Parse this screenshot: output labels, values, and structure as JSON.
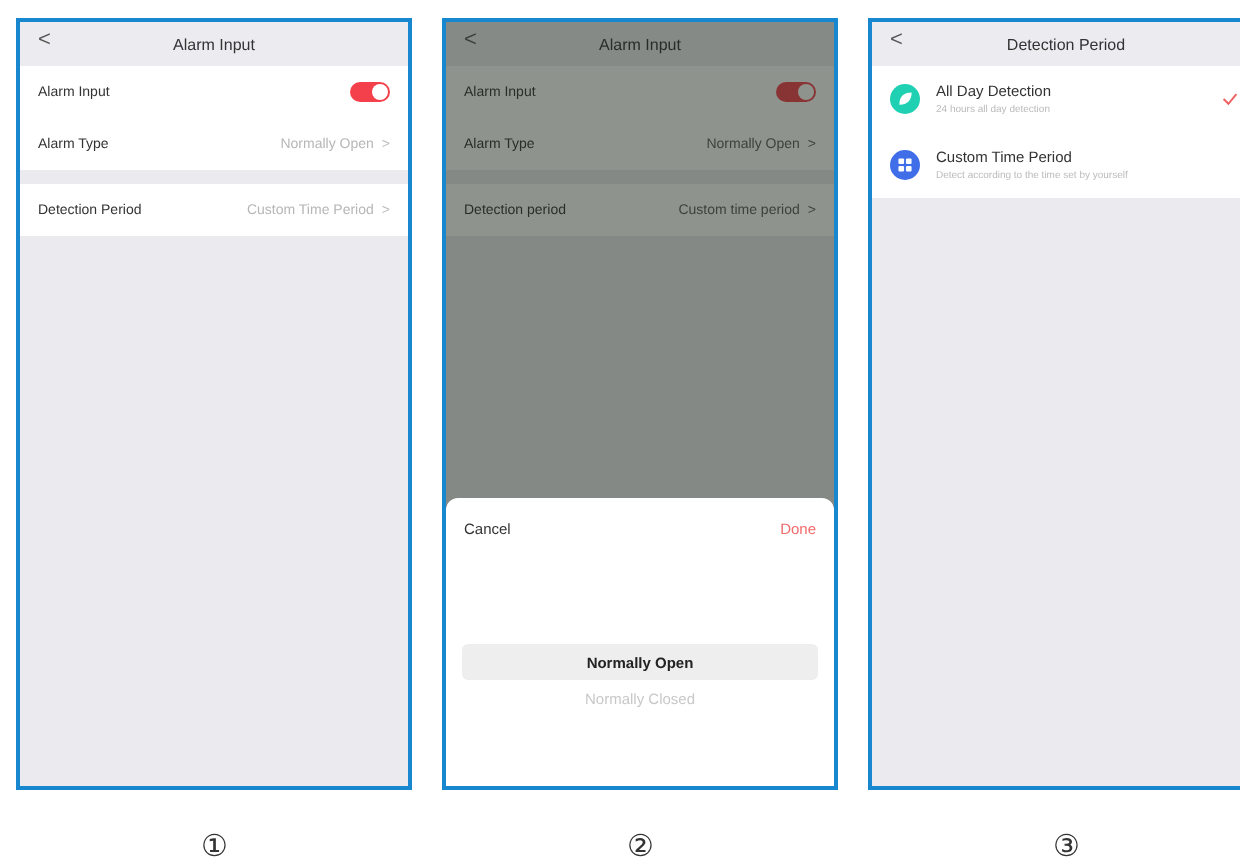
{
  "screens": [
    {
      "kind": "settings",
      "title": "Alarm Input",
      "back": "<",
      "dimmed": false,
      "groups": [
        {
          "rows": [
            {
              "kind": "toggle",
              "label": "Alarm Input",
              "on": true
            },
            {
              "kind": "value",
              "label": "Alarm Type",
              "value": "Normally Open",
              "chevron": ">"
            }
          ]
        },
        {
          "rows": [
            {
              "kind": "value",
              "label": "Detection Period",
              "value": "Custom Time Period",
              "chevron": ">"
            }
          ]
        }
      ],
      "caption": "①"
    },
    {
      "kind": "settings",
      "title": "Alarm Input",
      "back": "<",
      "dimmed": true,
      "groups": [
        {
          "rows": [
            {
              "kind": "toggle",
              "label": "Alarm Input",
              "on": true
            },
            {
              "kind": "value",
              "label": "Alarm Type",
              "value": "Normally Open",
              "chevron": ">"
            }
          ]
        },
        {
          "rows": [
            {
              "kind": "value",
              "label": "Detection period",
              "value": "Custom time period",
              "chevron": ">"
            }
          ]
        }
      ],
      "picker": {
        "cancel": "Cancel",
        "done": "Done",
        "options": [
          {
            "label": "Normally Open",
            "selected": true
          },
          {
            "label": "Normally Closed",
            "selected": false
          }
        ]
      },
      "caption": "②"
    },
    {
      "kind": "options",
      "title": "Detection Period",
      "back": "<",
      "options": [
        {
          "kind": "leaf",
          "title": "All Day Detection",
          "subtitle": "24 hours all day detection",
          "color": "#1fd1b2",
          "selected": true
        },
        {
          "kind": "grid",
          "title": "Custom Time Period",
          "subtitle": "Detect according to the time set by yourself",
          "color": "#3f6ee8",
          "selected": false
        }
      ],
      "caption": "③"
    }
  ]
}
